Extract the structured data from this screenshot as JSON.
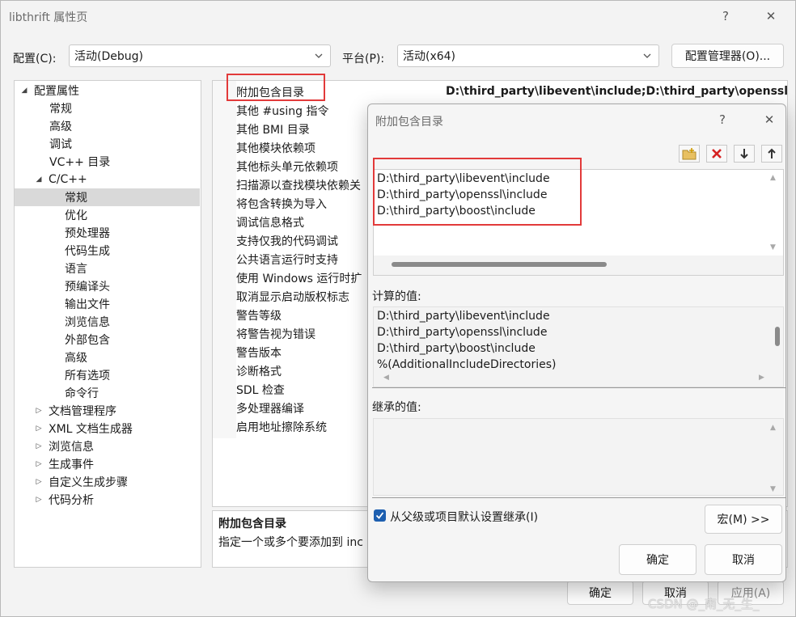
{
  "window": {
    "title": "libthrift 属性页",
    "help_label": "?",
    "close_label": "✕"
  },
  "config_bar": {
    "config_label": "配置(C):",
    "config_value": "活动(Debug)",
    "platform_label": "平台(P):",
    "platform_value": "活动(x64)",
    "manager_button": "配置管理器(O)..."
  },
  "tree": {
    "items": [
      {
        "label": "配置属性",
        "caret": "◢"
      },
      {
        "label": "常规"
      },
      {
        "label": "高级"
      },
      {
        "label": "调试"
      },
      {
        "label": "VC++ 目录"
      },
      {
        "label": "C/C++",
        "caret": "◢"
      },
      {
        "label": "常规",
        "selected": true
      },
      {
        "label": "优化"
      },
      {
        "label": "预处理器"
      },
      {
        "label": "代码生成"
      },
      {
        "label": "语言"
      },
      {
        "label": "预编译头"
      },
      {
        "label": "输出文件"
      },
      {
        "label": "浏览信息"
      },
      {
        "label": "外部包含"
      },
      {
        "label": "高级"
      },
      {
        "label": "所有选项"
      },
      {
        "label": "命令行"
      },
      {
        "label": "文档管理程序",
        "caret": "▷"
      },
      {
        "label": "XML 文档生成器",
        "caret": "▷"
      },
      {
        "label": "浏览信息",
        "caret": "▷"
      },
      {
        "label": "生成事件",
        "caret": "▷"
      },
      {
        "label": "自定义生成步骤",
        "caret": "▷"
      },
      {
        "label": "代码分析",
        "caret": "▷"
      }
    ]
  },
  "properties": {
    "rows": [
      "附加包含目录",
      "其他 #using 指令",
      "其他 BMI 目录",
      "其他模块依赖项",
      "其他标头单元依赖项",
      "扫描源以查找模块依赖关",
      "将包含转换为导入",
      "调试信息格式",
      "支持仅我的代码调试",
      "公共语言运行时支持",
      "使用 Windows 运行时扩",
      "取消显示启动版权标志",
      "警告等级",
      "将警告视为错误",
      "警告版本",
      "诊断格式",
      "SDL 检查",
      "多处理器编译",
      "启用地址擦除系统"
    ],
    "first_value": "D:\\third_party\\libevent\\include;D:\\third_party\\openssl\\i"
  },
  "description": {
    "title": "附加包含目录",
    "text": "指定一个或多个要添加到 inc"
  },
  "bottom_buttons": {
    "ok": "确定",
    "cancel": "取消",
    "apply": "应用(A)"
  },
  "watermark": "CSDN @_南_无_生_",
  "dialog": {
    "title": "附加包含目录",
    "help_label": "?",
    "close_label": "✕",
    "entries": [
      "D:\\third_party\\libevent\\include",
      "D:\\third_party\\openssl\\include",
      "D:\\third_party\\boost\\include"
    ],
    "computed_label": "计算的值:",
    "computed_lines": [
      "D:\\third_party\\libevent\\include",
      "D:\\third_party\\openssl\\include",
      "D:\\third_party\\boost\\include",
      "%(AdditionalIncludeDirectories)"
    ],
    "inherited_label": "继承的值:",
    "inherit_checkbox_label": "从父级或项目默认设置继承(I)",
    "inherit_checked": true,
    "macro_button": "宏(M) >>",
    "ok": "确定",
    "cancel": "取消"
  }
}
